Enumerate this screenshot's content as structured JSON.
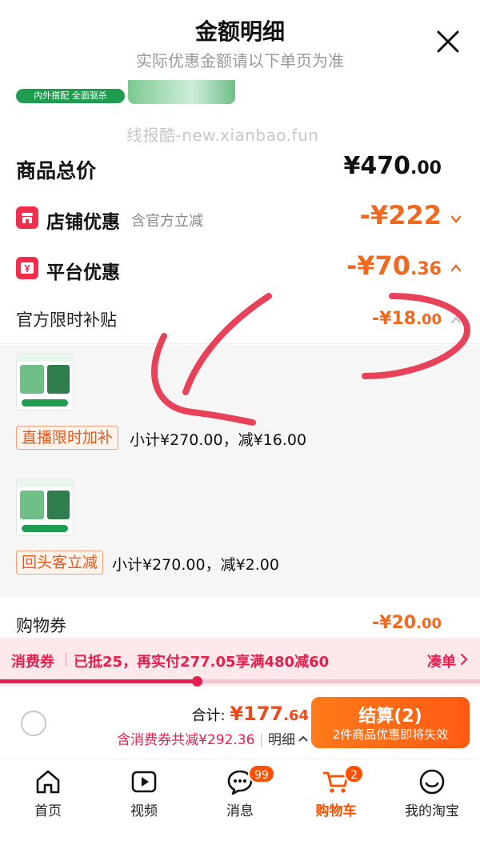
{
  "header": {
    "title": "金额明细",
    "subtitle": "实际优惠金额请以下单页为准"
  },
  "top_strip": {
    "badge_text": "内外搭配 全面驱杀"
  },
  "watermark": "线报酷-new.xianbao.fun",
  "total": {
    "label": "商品总价",
    "currency": "¥",
    "integer": "470",
    "decimal": ".00"
  },
  "store_discount": {
    "label": "店铺优惠",
    "hint": "含官方立减",
    "amount": "-¥222",
    "icon": "store-icon",
    "expanded": false
  },
  "platform_discount": {
    "label": "平台优惠",
    "amount_main": "-¥70",
    "amount_decimal": ".36",
    "icon": "yen-ticket-icon",
    "expanded": true
  },
  "subsidy": {
    "label": "官方限时补贴",
    "amount_main": "-¥18",
    "amount_decimal": ".00",
    "expanded": true
  },
  "deals": [
    {
      "tag": "直播限时加补",
      "text": "小计¥270.00，减¥16.00"
    },
    {
      "tag": "回头客立减",
      "text": "小计¥270.00，减¥2.00"
    }
  ],
  "coupon": {
    "label": "购物券",
    "amount_main": "-¥20",
    "amount_decimal": ".00"
  },
  "promo": {
    "label": "消费券",
    "text": "已抵25，再实付277.05享满480减60",
    "action": "凑单",
    "progress": 0.41
  },
  "checkout": {
    "sum_label": "合计: ",
    "sum_main": "¥177",
    "sum_decimal": ".64",
    "sub_text": "含消费券共减¥292.36",
    "detail_link": "明细",
    "pay_main": "结算(2)",
    "pay_sub": "2件商品优惠即将失效"
  },
  "tabs": [
    {
      "label": "首页",
      "icon": "home-icon"
    },
    {
      "label": "视频",
      "icon": "video-icon"
    },
    {
      "label": "消息",
      "icon": "message-icon",
      "badge": "99"
    },
    {
      "label": "购物车",
      "icon": "cart-icon",
      "badge": "2",
      "active": true
    },
    {
      "label": "我的淘宝",
      "icon": "profile-icon"
    }
  ],
  "colors": {
    "accent": "#f0691e",
    "brand_red": "#f22e4c",
    "promo_red": "#e61e4d",
    "annotation": "#e8415a"
  }
}
